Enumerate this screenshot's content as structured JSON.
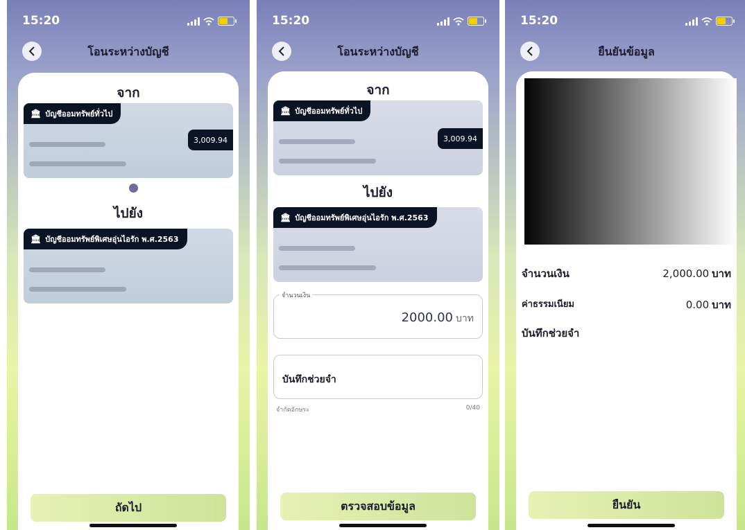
{
  "status_time": "15:20",
  "screen1": {
    "title": "โอนระหว่างบัญชี",
    "from_label": "จาก",
    "from_account": "บัญชีออมทรัพย์ทั่วไป",
    "from_balance": "3,009.94",
    "to_label": "ไปยัง",
    "to_account": "บัญชีออมทรัพย์พิเศษอุ่นไอรัก พ.ศ.2563",
    "next_button": "ถัดไป"
  },
  "screen2": {
    "title": "โอนระหว่างบัญชี",
    "from_label": "จาก",
    "from_account": "บัญชีออมทรัพย์ทั่วไป",
    "from_balance": "3,009.94",
    "to_label": "ไปยัง",
    "to_account": "บัญชีออมทรัพย์พิเศษอุ่นไอรัก พ.ศ.2563",
    "amount_legend": "จำนวนเงิน",
    "amount_value": "2000.00",
    "amount_unit": "บาท",
    "memo_placeholder": "บันทึกช่วยจำ",
    "char_limit_label": "จำกัดอักษระ",
    "char_count": "0/40",
    "check_button": "ตรวจสอบข้อมูล"
  },
  "screen3": {
    "title": "ยืนยันข้อมูล",
    "amount_label": "จำนวนเงิน",
    "amount_value": "2,000.00",
    "amount_unit": "บาท",
    "fee_label": "ค่าธรรมเนียม",
    "fee_value": "0.00",
    "fee_unit": "บาท",
    "memo_label": "บันทึกช่วยจำ",
    "confirm_button": "ยืนยัน"
  },
  "icons": {
    "back": "chevron-left-icon",
    "bank": "bank-icon",
    "signal": "signal-icon",
    "wifi": "wifi-icon",
    "battery": "battery-icon"
  },
  "colors": {
    "primary_dark": "#0b1424",
    "button_gradient_start": "#e7f1b4",
    "button_gradient_end": "#cde39a",
    "header_purple": "#7a80b8"
  }
}
